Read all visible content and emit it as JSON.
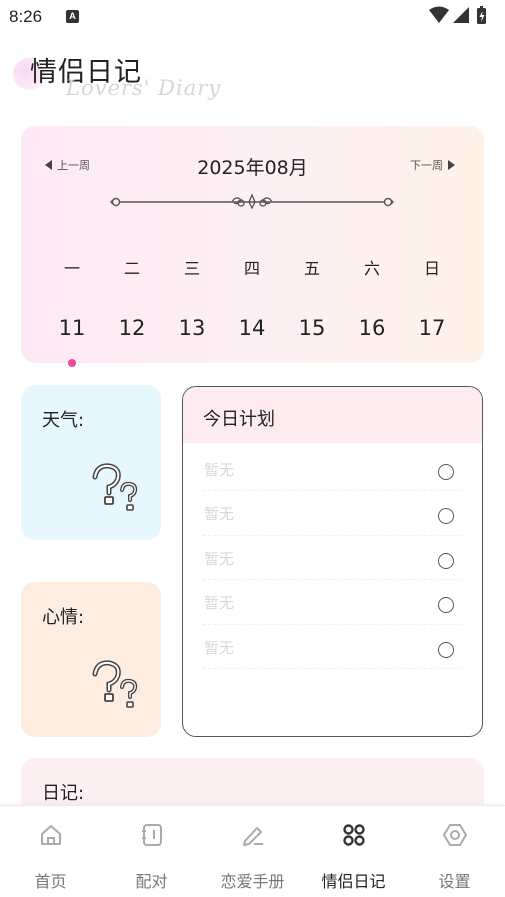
{
  "status_bar": {
    "time": "8:26",
    "notification_badge": "A"
  },
  "header": {
    "title": "情侣日记",
    "subtitle": "Lovers' Diary"
  },
  "calendar": {
    "prev_week_label": "上一周",
    "next_week_label": "下一周",
    "month_label": "2025年08月",
    "weekdays": [
      "一",
      "二",
      "三",
      "四",
      "五",
      "六",
      "日"
    ],
    "dates": [
      "11",
      "12",
      "13",
      "14",
      "15",
      "16",
      "17"
    ],
    "selected_date": "11",
    "accent_color": "#e84a9b"
  },
  "weather": {
    "label": "天气:",
    "icon": "question-marks-icon"
  },
  "mood": {
    "label": "心情:",
    "icon": "question-marks-icon"
  },
  "plan": {
    "title": "今日计划",
    "items": [
      "暂无",
      "暂无",
      "暂无",
      "暂无",
      "暂无"
    ]
  },
  "diary": {
    "label": "日记:"
  },
  "tab_bar": {
    "tabs": [
      {
        "label": "首页",
        "icon": "home-icon"
      },
      {
        "label": "配对",
        "icon": "notebook-icon"
      },
      {
        "label": "恋爱手册",
        "icon": "pen-icon"
      },
      {
        "label": "情侣日记",
        "icon": "grid-clover-icon",
        "active": true
      },
      {
        "label": "设置",
        "icon": "settings-hexagon-icon"
      }
    ]
  }
}
